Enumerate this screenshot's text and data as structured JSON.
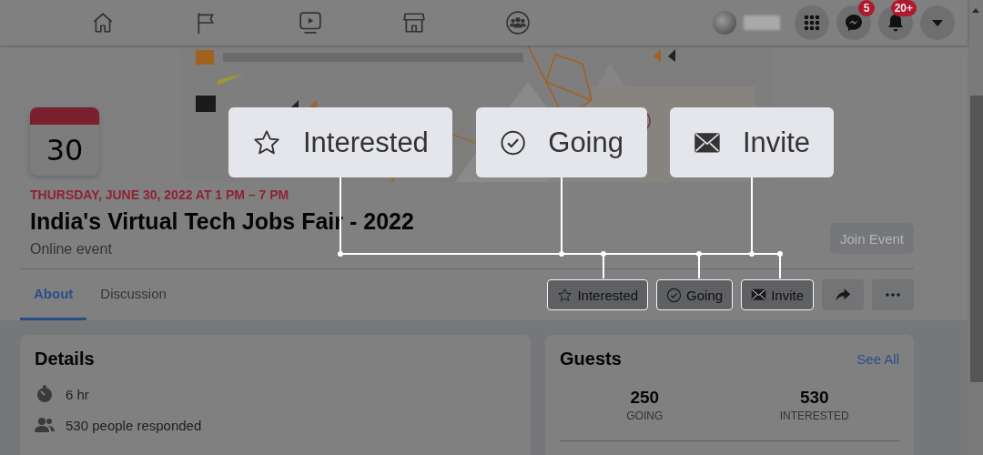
{
  "top_bar": {
    "messenger_badge": "5",
    "notifications_badge": "20+"
  },
  "event": {
    "date_day": "30",
    "date_line": "THURSDAY, JUNE 30, 2022 AT 1 PM – 7 PM",
    "title": "India's Virtual Tech Jobs Fair - 2022",
    "location": "Online event",
    "join_button": {
      "label": "Join Event",
      "disabled": true
    }
  },
  "tabs": [
    {
      "label": "About",
      "selected": true
    },
    {
      "label": "Discussion",
      "selected": false
    }
  ],
  "actions": [
    {
      "kind": "interested",
      "label": "Interested",
      "highlighted": true
    },
    {
      "kind": "going",
      "label": "Going",
      "highlighted": true
    },
    {
      "kind": "invite",
      "label": "Invite",
      "highlighted": true
    },
    {
      "kind": "share",
      "highlighted": false
    },
    {
      "kind": "more",
      "highlighted": false
    }
  ],
  "details": {
    "title": "Details",
    "rows": [
      {
        "kind": "duration",
        "text": "6 hr"
      },
      {
        "kind": "people",
        "text": "530 people responded"
      }
    ]
  },
  "guests": {
    "title": "Guests",
    "see_all": "See All",
    "stats": [
      {
        "count": "250",
        "label": "GOING"
      },
      {
        "count": "530",
        "label": "INTERESTED"
      }
    ]
  },
  "callouts": [
    {
      "kind": "interested",
      "label": "Interested"
    },
    {
      "kind": "going",
      "label": "Going"
    },
    {
      "kind": "invite",
      "label": "Invite"
    }
  ]
}
